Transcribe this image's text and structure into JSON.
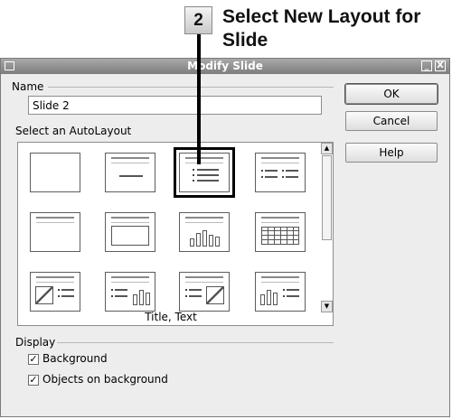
{
  "annotation": {
    "step_number": "2",
    "step_text": "Select New Layout for Slide"
  },
  "window": {
    "title": "Modify Slide",
    "minimize_glyph": "_",
    "close_glyph": "X"
  },
  "name_section": {
    "label": "Name",
    "value": "Slide 2"
  },
  "autolayout_section": {
    "label": "Select an AutoLayout",
    "selected_caption": "Title, Text",
    "layouts": [
      "blank",
      "title-only",
      "title-text",
      "title-2-text",
      "title-text-chart",
      "title-chart",
      "title-text-clipart",
      "title-table",
      "title-clipart-text",
      "title-text-chart-2",
      "title-text-clipart",
      "title-chart-text"
    ]
  },
  "scrollbar": {
    "up_glyph": "▲",
    "down_glyph": "▼"
  },
  "buttons": {
    "ok": "OK",
    "cancel": "Cancel",
    "help": "Help"
  },
  "display_section": {
    "label": "Display",
    "background_label": "Background",
    "background_checked": true,
    "objects_label": "Objects on background",
    "objects_checked": true,
    "check_glyph": "✓"
  },
  "colors": {
    "titlebar": "#8f8f8f",
    "dialog_bg": "#ededed",
    "selection_border": "#000000"
  }
}
